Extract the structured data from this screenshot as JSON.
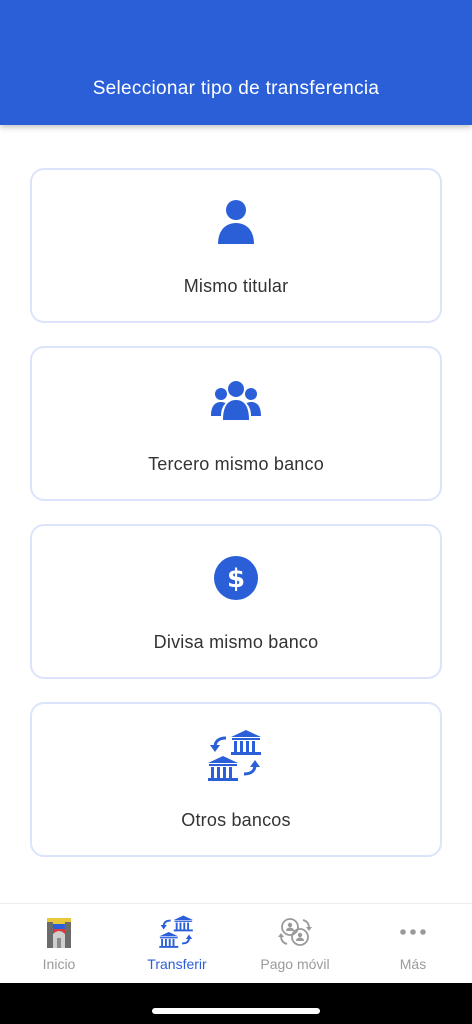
{
  "header": {
    "title": "Seleccionar tipo de transferencia"
  },
  "options": [
    {
      "label": "Mismo titular",
      "icon": "person-icon"
    },
    {
      "label": "Tercero mismo banco",
      "icon": "group-icon"
    },
    {
      "label": "Divisa mismo banco",
      "icon": "dollar-circle-icon"
    },
    {
      "label": "Otros bancos",
      "icon": "bank-transfer-icon"
    }
  ],
  "tabs": [
    {
      "label": "Inicio",
      "icon": "home-logo-icon",
      "active": false
    },
    {
      "label": "Transferir",
      "icon": "bank-transfer-icon",
      "active": true
    },
    {
      "label": "Pago móvil",
      "icon": "mobile-payment-icon",
      "active": false
    },
    {
      "label": "Más",
      "icon": "more-dots-icon",
      "active": false
    }
  ],
  "colors": {
    "primary": "#2A5FD8",
    "card_border": "#DCE4FB",
    "inactive": "#9A9A9A",
    "text": "#333333"
  }
}
